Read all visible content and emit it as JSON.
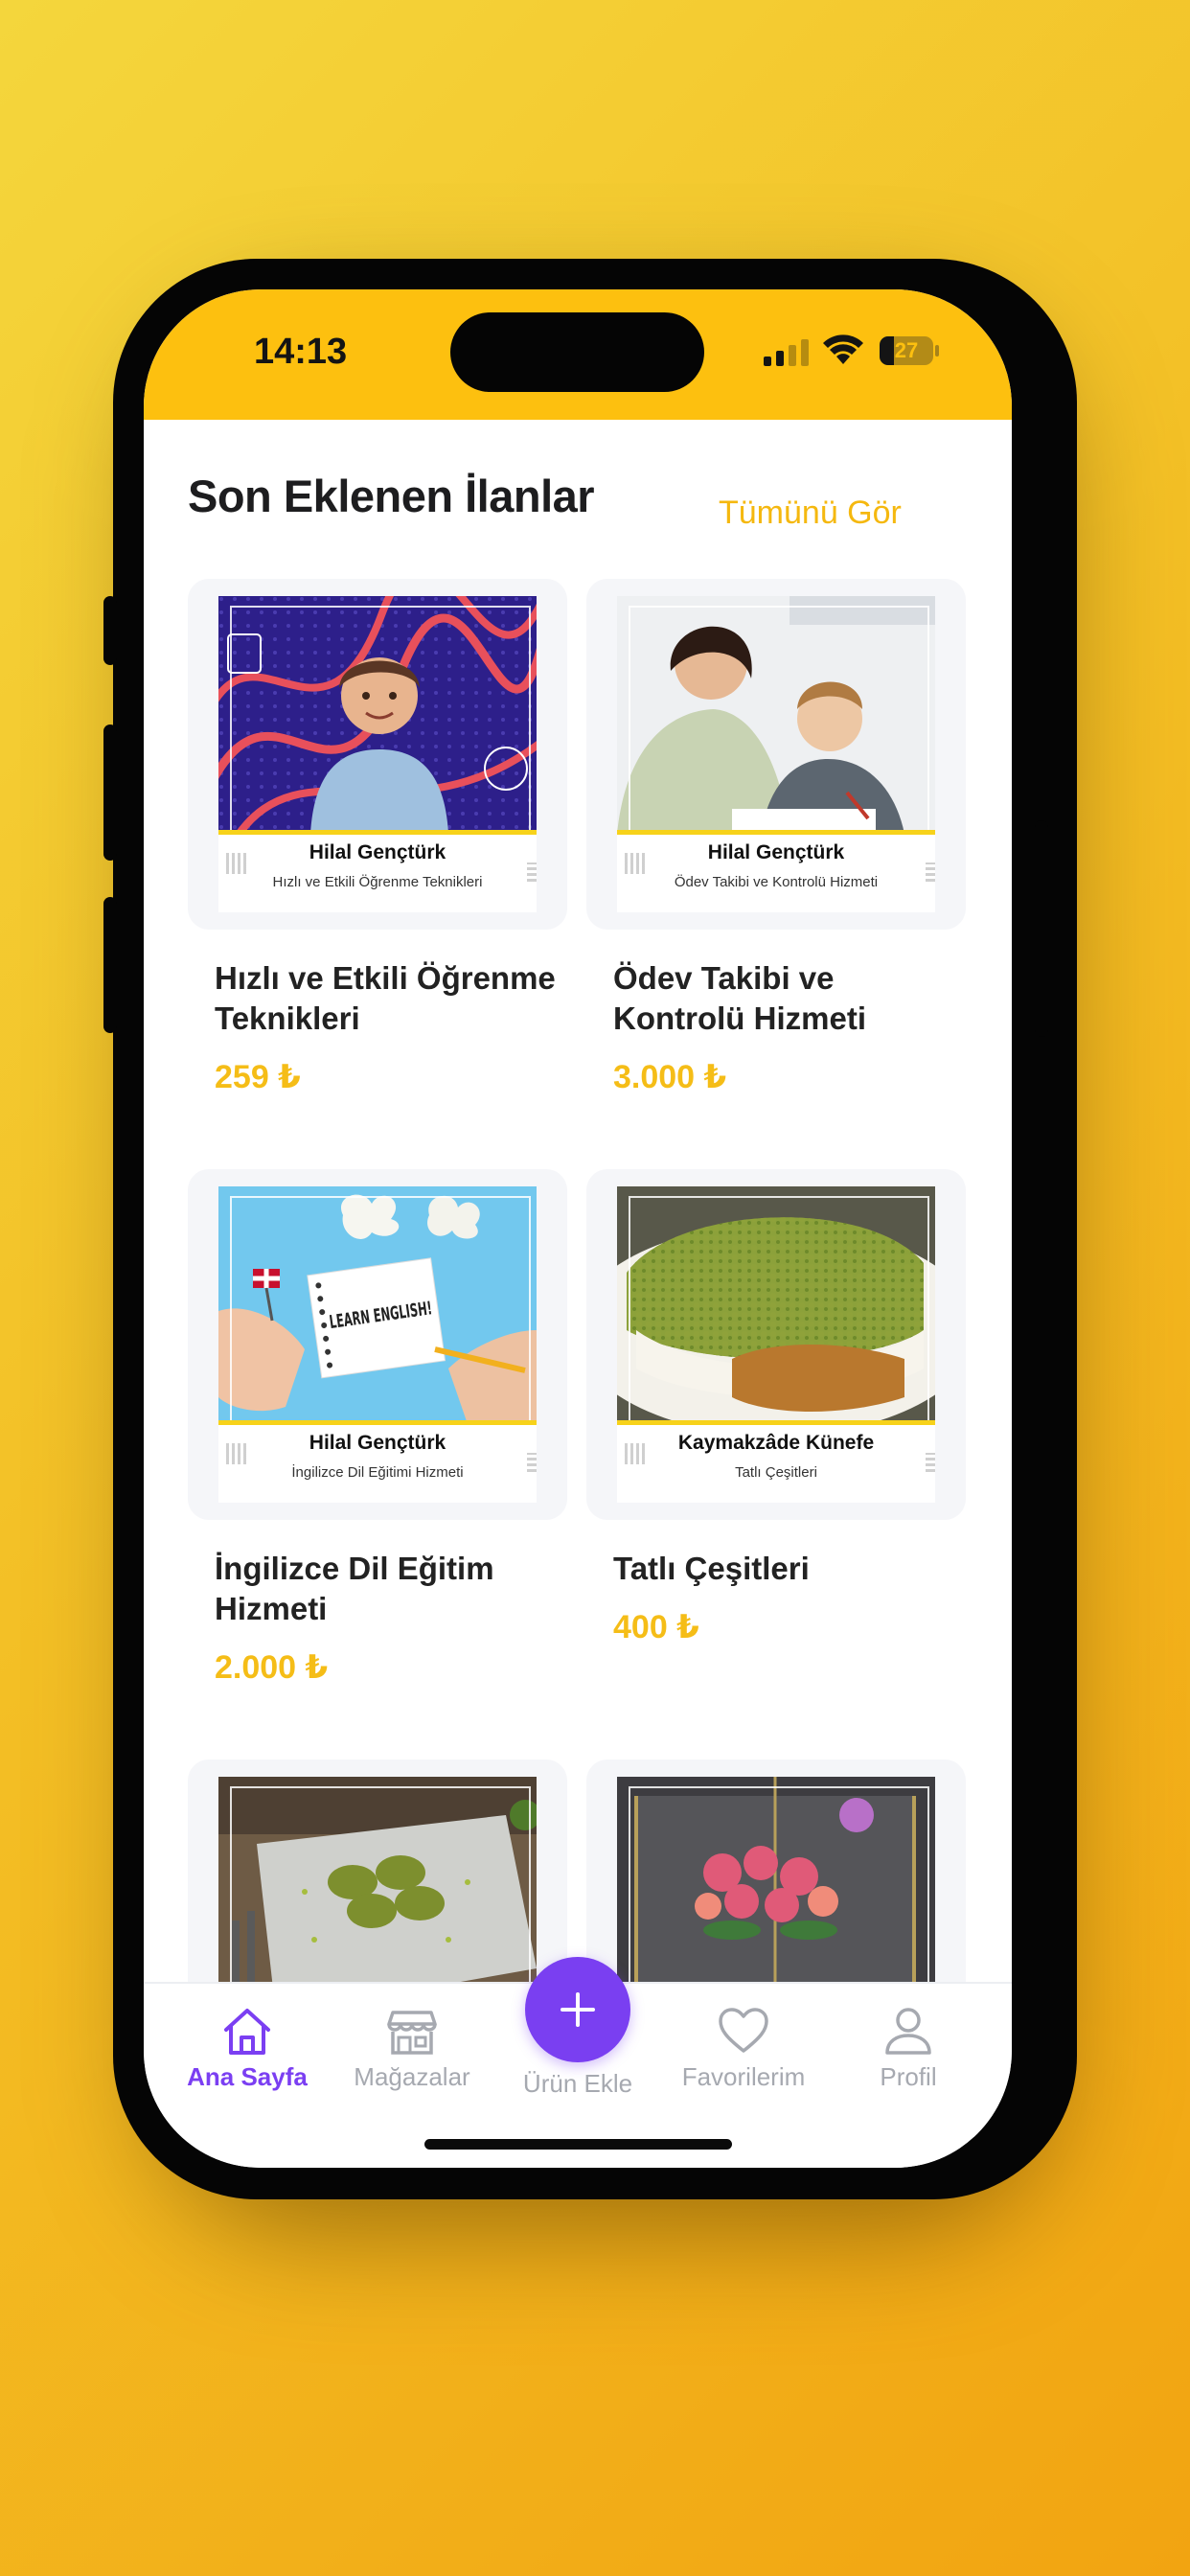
{
  "status_bar": {
    "time": "14:13",
    "battery": "27",
    "battery_level": 0.27
  },
  "section": {
    "title": "Son Eklenen İlanlar",
    "see_all": "Tümünü Gör"
  },
  "listings": [
    {
      "seller": "Hilal Gençtürk",
      "subtitle": "Hızlı ve Etkili Öğrenme Teknikleri",
      "title": "Hızlı ve Etkili Öğrenme Teknikleri",
      "price": "259 ₺"
    },
    {
      "seller": "Hilal Gençtürk",
      "subtitle": "Ödev Takibi ve Kontrolü Hizmeti",
      "title": "Ödev Takibi ve Kontrolü Hizmeti",
      "price": "3.000 ₺"
    },
    {
      "seller": "Hilal Gençtürk",
      "subtitle": "İngilizce Dil Eğitimi Hizmeti",
      "title": "İngilizce Dil Eğitim Hizmeti",
      "price": "2.000 ₺",
      "image_text": "LEARN ENGLISH!"
    },
    {
      "seller": "Kaymakzâde Künefe",
      "subtitle": "Tatlı Çeşitleri",
      "title": "Tatlı Çeşitleri",
      "price": "400 ₺"
    }
  ],
  "tabbar": {
    "home": "Ana Sayfa",
    "stores": "Mağazalar",
    "add": "Ürün Ekle",
    "favorites": "Favorilerim",
    "profile": "Profil"
  },
  "colors": {
    "accent": "#7a3ff1",
    "brand_yellow": "#fdc00f",
    "price": "#f5bd17"
  },
  "icons": [
    "home-icon",
    "store-icon",
    "plus-icon",
    "heart-icon",
    "profile-icon",
    "wifi-icon",
    "signal-icon",
    "battery-icon"
  ]
}
